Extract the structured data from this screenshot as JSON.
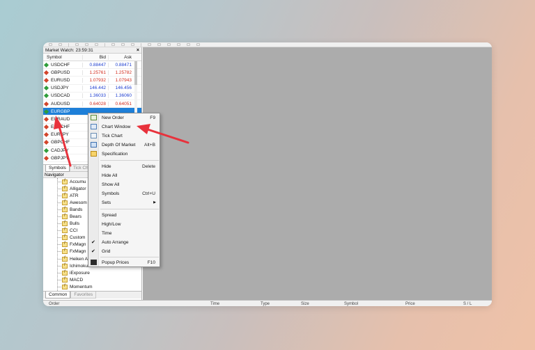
{
  "market_watch": {
    "title": "Market Watch: 23:59:31",
    "close": "×",
    "columns": {
      "symbol": "Symbol",
      "bid": "Bid",
      "ask": "Ask"
    },
    "rows": [
      {
        "symbol": "USDCHF",
        "dir": "up",
        "bid": "0.88447",
        "ask": "0.88471",
        "bid_color": "blue",
        "ask_color": "blue"
      },
      {
        "symbol": "GBPUSD",
        "dir": "down",
        "bid": "1.25761",
        "ask": "1.25782",
        "bid_color": "red",
        "ask_color": "red"
      },
      {
        "symbol": "EURUSD",
        "dir": "down",
        "bid": "1.07932",
        "ask": "1.07943",
        "bid_color": "red",
        "ask_color": "red"
      },
      {
        "symbol": "USDJPY",
        "dir": "up",
        "bid": "146.442",
        "ask": "146.456",
        "bid_color": "blue",
        "ask_color": "blue"
      },
      {
        "symbol": "USDCAD",
        "dir": "up",
        "bid": "1.36033",
        "ask": "1.36060",
        "bid_color": "blue",
        "ask_color": "blue"
      },
      {
        "symbol": "AUDUSD",
        "dir": "down",
        "bid": "0.64028",
        "ask": "0.64051",
        "bid_color": "red",
        "ask_color": "red"
      },
      {
        "symbol": "EURGBP",
        "dir": "up",
        "bid": "",
        "ask": "",
        "selected": true
      },
      {
        "symbol": "EURAUD",
        "dir": "down",
        "bid": "",
        "ask": ""
      },
      {
        "symbol": "EURCHF",
        "dir": "down",
        "bid": "",
        "ask": ""
      },
      {
        "symbol": "EURJPY",
        "dir": "down",
        "bid": "",
        "ask": ""
      },
      {
        "symbol": "GBPCHF",
        "dir": "down",
        "bid": "",
        "ask": ""
      },
      {
        "symbol": "CADJPY",
        "dir": "up",
        "bid": "",
        "ask": ""
      },
      {
        "symbol": "GBPJPY",
        "dir": "down",
        "bid": "",
        "ask": ""
      }
    ],
    "tabs": [
      "Symbols",
      "Tick Ch"
    ]
  },
  "navigator": {
    "title": "Navigator",
    "items": [
      "Accumu",
      "Alligator",
      "ATR",
      "Awesom",
      "Bands",
      "Bears",
      "Bulls",
      "CCI",
      "Custom",
      "FxMagn",
      "FxMagn",
      "Heiken A",
      "Ichimoku",
      "iExposure",
      "MACD",
      "Momentum"
    ],
    "tabs": [
      "Common",
      "Favorites"
    ]
  },
  "context_menu": {
    "items": [
      {
        "label": "New Order",
        "shortcut": "F9",
        "icon": "new-order-icon"
      },
      {
        "label": "Chart Window",
        "shortcut": "",
        "icon": "chart-window-icon"
      },
      {
        "label": "Tick Chart",
        "shortcut": "",
        "icon": "tick-chart-icon"
      },
      {
        "label": "Depth Of Market",
        "shortcut": "Alt+B",
        "icon": "depth-of-market-icon"
      },
      {
        "label": "Specification",
        "shortcut": "",
        "icon": "specification-icon"
      },
      {
        "label": "Hide",
        "shortcut": "Delete"
      },
      {
        "label": "Hide All",
        "shortcut": ""
      },
      {
        "label": "Show All",
        "shortcut": ""
      },
      {
        "label": "Symbols",
        "shortcut": "Ctrl+U"
      },
      {
        "label": "Sets",
        "shortcut": "",
        "submenu": true
      },
      {
        "label": "Spread",
        "shortcut": ""
      },
      {
        "label": "High/Low",
        "shortcut": ""
      },
      {
        "label": "Time",
        "shortcut": ""
      },
      {
        "label": "Auto Arrange",
        "shortcut": "",
        "checked": true
      },
      {
        "label": "Grid",
        "shortcut": "",
        "checked": true
      },
      {
        "label": "Popup Prices",
        "shortcut": "F10",
        "icon": "popup-prices-icon"
      }
    ]
  },
  "bottom_panel": {
    "columns": [
      "Order",
      "Time",
      "Type",
      "Size",
      "Symbol",
      "Price",
      "S / L"
    ]
  },
  "colors": {
    "selected_row": "#1e7fd8",
    "price_up": "#1f3fd0",
    "price_down": "#d22b1c",
    "chart_bg": "#acacac",
    "annotation_arrow": "#e8323c"
  }
}
